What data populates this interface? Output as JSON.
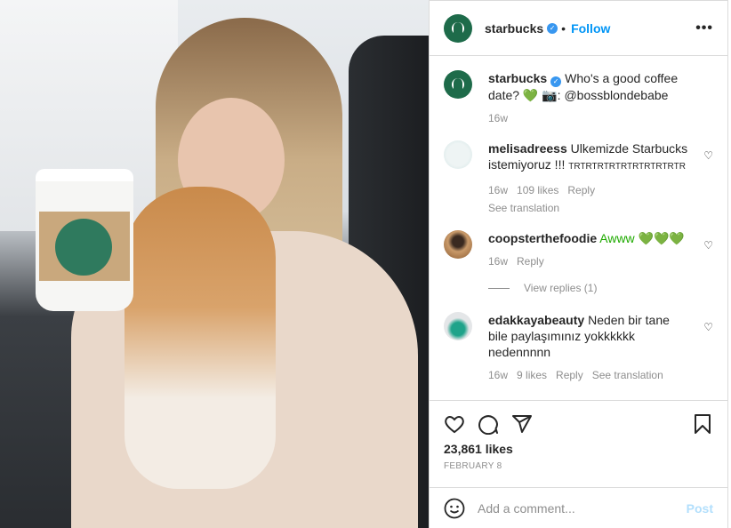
{
  "post": {
    "username": "starbucks",
    "follow_label": "Follow",
    "more": "•••",
    "separator": "•"
  },
  "caption": {
    "username": "starbucks",
    "text": "Who's a good coffee date? 💚 📷: @bossblondebabe",
    "time": "16w"
  },
  "comments": [
    {
      "username": "melisadreess",
      "text": "Ulkemizde Starbucks istemiyoruz !!!",
      "small": "TRTRTRTRTRTRTRTRTRTR",
      "time": "16w",
      "likes": "109 likes",
      "reply": "Reply",
      "translate": "See translation"
    },
    {
      "username": "coopsterthefoodie",
      "text": "Awww 💚💚💚",
      "time": "16w",
      "reply": "Reply",
      "view_replies": "View replies (1)"
    },
    {
      "username": "edakkayabeauty",
      "text": "Neden bir tane bile paylaşımınız yokkkkkk nedennnnn",
      "time": "16w",
      "likes": "9 likes",
      "reply": "Reply",
      "translate": "See translation"
    }
  ],
  "likes": "23,861 likes",
  "date": "FEBRUARY 8",
  "comment_input": {
    "placeholder": "Add a comment...",
    "post_label": "Post"
  },
  "colors": {
    "accent": "#0095f6",
    "border": "#dbdbdb",
    "muted": "#8e8e8e"
  }
}
